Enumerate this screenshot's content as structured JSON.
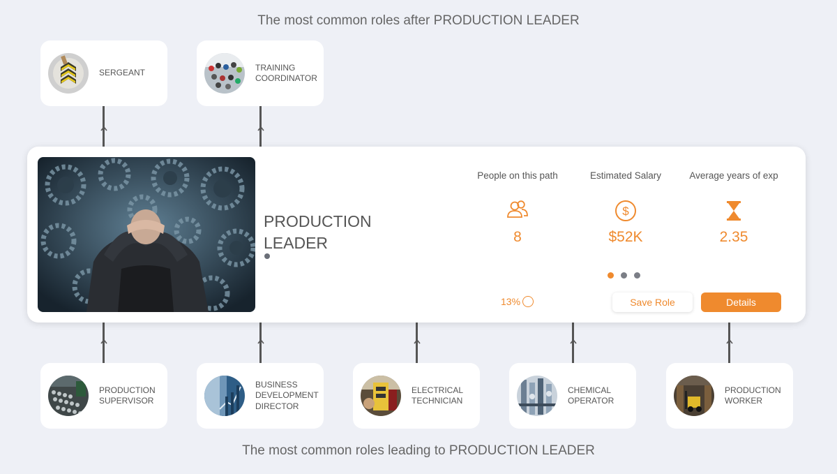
{
  "headings": {
    "after": "The most common roles after PRODUCTION LEADER",
    "before": "The most common roles leading to PRODUCTION LEADER"
  },
  "next_roles": [
    {
      "title": "SERGEANT",
      "image": "sergeant-chevron-image"
    },
    {
      "title": "TRAINING COORDINATOR",
      "image": "training-group-image"
    }
  ],
  "previous_roles": [
    {
      "title": "PRODUCTION SUPERVISOR",
      "image": "factory-line-image"
    },
    {
      "title": "BUSINESS DEVELOPMENT DIRECTOR",
      "image": "business-growth-image"
    },
    {
      "title": "ELECTRICAL TECHNICIAN",
      "image": "electrician-image"
    },
    {
      "title": "CHEMICAL OPERATOR",
      "image": "chemical-plant-image"
    },
    {
      "title": "PRODUCTION WORKER",
      "image": "warehouse-forklift-image"
    }
  ],
  "current_role": {
    "title": "PRODUCTION LEADER",
    "image": "businessman-gears-image",
    "stats": [
      {
        "label": "People on this path",
        "value": "8",
        "icon": "people-icon"
      },
      {
        "label": "Estimated Salary",
        "value": "$52K",
        "icon": "dollar-icon"
      },
      {
        "label": "Average years of exp",
        "value": "2.35",
        "icon": "hourglass-icon"
      }
    ],
    "pager": {
      "total": 3,
      "active": 0
    },
    "percent": "13%",
    "save_label": "Save Role",
    "details_label": "Details"
  },
  "colors": {
    "accent": "#ef8a2e",
    "background": "#eef0f6",
    "text": "#555555"
  }
}
